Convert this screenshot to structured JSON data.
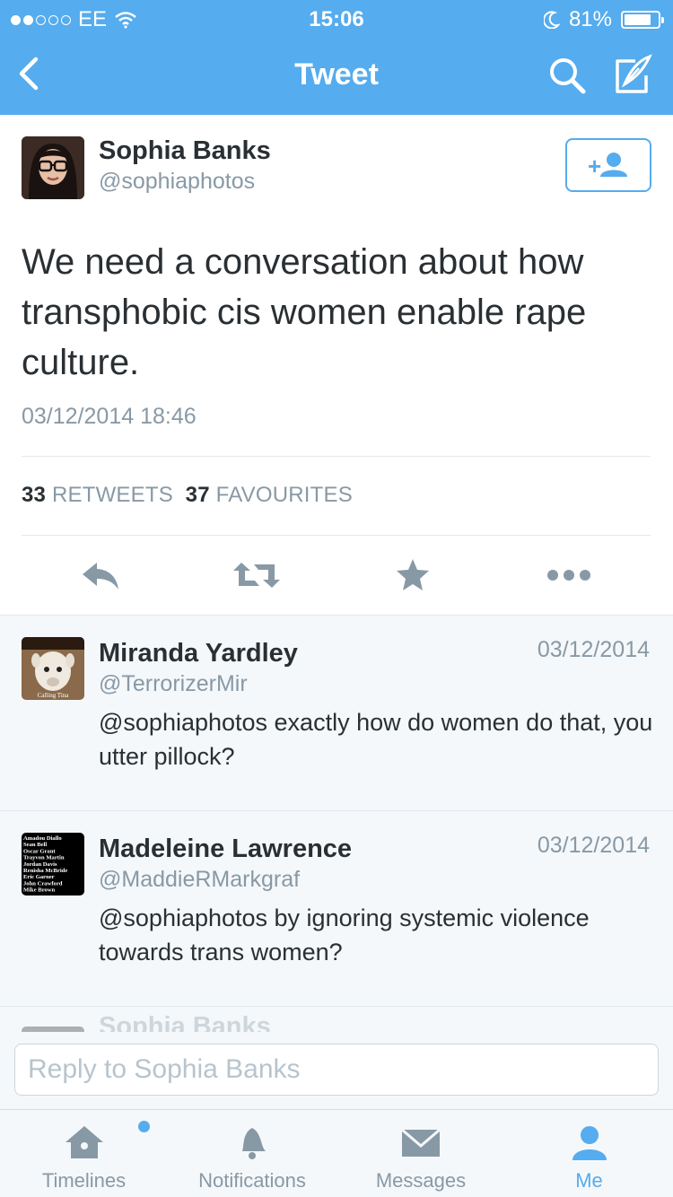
{
  "status_bar": {
    "carrier": "EE",
    "time": "15:06",
    "battery": "81%",
    "battery_level": 0.81,
    "signal_bars_filled": 2,
    "signal_bars_total": 5
  },
  "nav": {
    "title": "Tweet",
    "back_icon": "chevron-left-icon",
    "search_icon": "search-icon",
    "compose_icon": "compose-icon"
  },
  "tweet": {
    "name": "Sophia Banks",
    "handle": "@sophiaphotos",
    "text": "We need a conversation about how transphobic cis women enable rape culture.",
    "timestamp": "03/12/2014 18:46",
    "retweets_count": "33",
    "retweets_label": "RETWEETS",
    "favourites_count": "37",
    "favourites_label": "FAVOURITES"
  },
  "replies": [
    {
      "name": "Miranda Yardley",
      "handle": "@TerrorizerMir",
      "date": "03/12/2014",
      "text": "@sophiaphotos exactly how do women do that, you utter pillock?",
      "avatar_caption": "Calling Tina"
    },
    {
      "name": "Madeleine Lawrence",
      "handle": "@MaddieRMarkgraf",
      "date": "03/12/2014",
      "text": "@sophiaphotos by ignoring systemic violence towards trans women?",
      "avatar_lines": [
        "Amadou Diallo",
        "Sean Bell",
        "Oscar Grant",
        "Trayvon Martin",
        "Jordan Davis",
        "Renisha McBride",
        "Eric Garner",
        "John Crawford",
        "Mike Brown"
      ]
    }
  ],
  "partial_reply": {
    "name": "Sophia Banks"
  },
  "reply_box": {
    "placeholder": "Reply to Sophia Banks"
  },
  "tabs": [
    {
      "label": "Timelines",
      "icon": "home-icon",
      "active": false
    },
    {
      "label": "Notifications",
      "icon": "bell-icon",
      "active": false
    },
    {
      "label": "Messages",
      "icon": "envelope-icon",
      "active": false
    },
    {
      "label": "Me",
      "icon": "person-icon",
      "active": true
    }
  ],
  "colors": {
    "brand": "#55acee",
    "text": "#292f33",
    "muted": "#8899a6",
    "reply_bg": "#f5f8fa"
  }
}
